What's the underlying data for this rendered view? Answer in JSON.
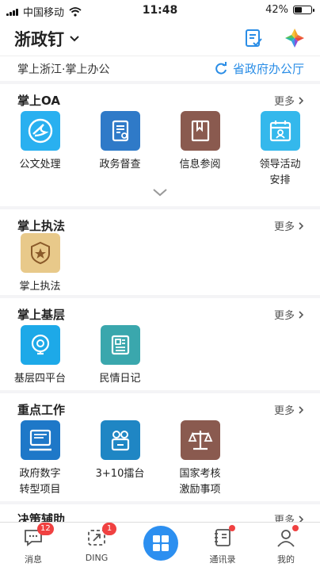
{
  "status": {
    "carrier": "中国移动",
    "time": "11:48",
    "battery": "42%",
    "battery_level": 0.42
  },
  "header": {
    "title": "浙政钉",
    "slogan": "掌上浙江·掌上办公",
    "org_label": "省政府办公厅"
  },
  "sections": {
    "oa": {
      "title": "掌上OA",
      "more": "更多",
      "apps": [
        {
          "label": "公文处理",
          "color": "#29b0f0",
          "icon": "document-flow-icon"
        },
        {
          "label": "政务督查",
          "color": "#2f7ac8",
          "icon": "supervision-icon"
        },
        {
          "label": "信息参阅",
          "color": "#8a5a4f",
          "icon": "bookmark-book-icon"
        },
        {
          "label": "领导活动\n安排",
          "color": "#34b8ec",
          "icon": "calendar-person-icon"
        }
      ]
    },
    "law": {
      "title": "掌上执法",
      "more": "更多",
      "apps": [
        {
          "label": "掌上执法",
          "color": "#e8c98a",
          "icon": "badge-star-icon"
        }
      ]
    },
    "grassroots": {
      "title": "掌上基层",
      "more": "更多",
      "apps": [
        {
          "label": "基层四平台",
          "color": "#1da9e8",
          "icon": "location-pin-icon"
        },
        {
          "label": "民情日记",
          "color": "#3aa7ad",
          "icon": "newspaper-icon"
        }
      ]
    },
    "key": {
      "title": "重点工作",
      "more": "更多",
      "apps": [
        {
          "label": "政府数字\n转型项目",
          "color": "#1e78c8",
          "icon": "digital-screen-icon"
        },
        {
          "label": "3+10擂台",
          "color": "#1f86c4",
          "icon": "arena-icon"
        },
        {
          "label": "国家考核\n激励事项",
          "color": "#8a5a4f",
          "icon": "scales-icon"
        }
      ]
    },
    "decision": {
      "title": "决策辅助",
      "more": "更多"
    }
  },
  "tabbar": [
    {
      "label": "消息",
      "badge": "12"
    },
    {
      "label": "DING",
      "badge": "1"
    },
    {
      "label": "",
      "badge": ""
    },
    {
      "label": "通讯录",
      "badge": ""
    },
    {
      "label": "我的",
      "badge": ""
    }
  ]
}
